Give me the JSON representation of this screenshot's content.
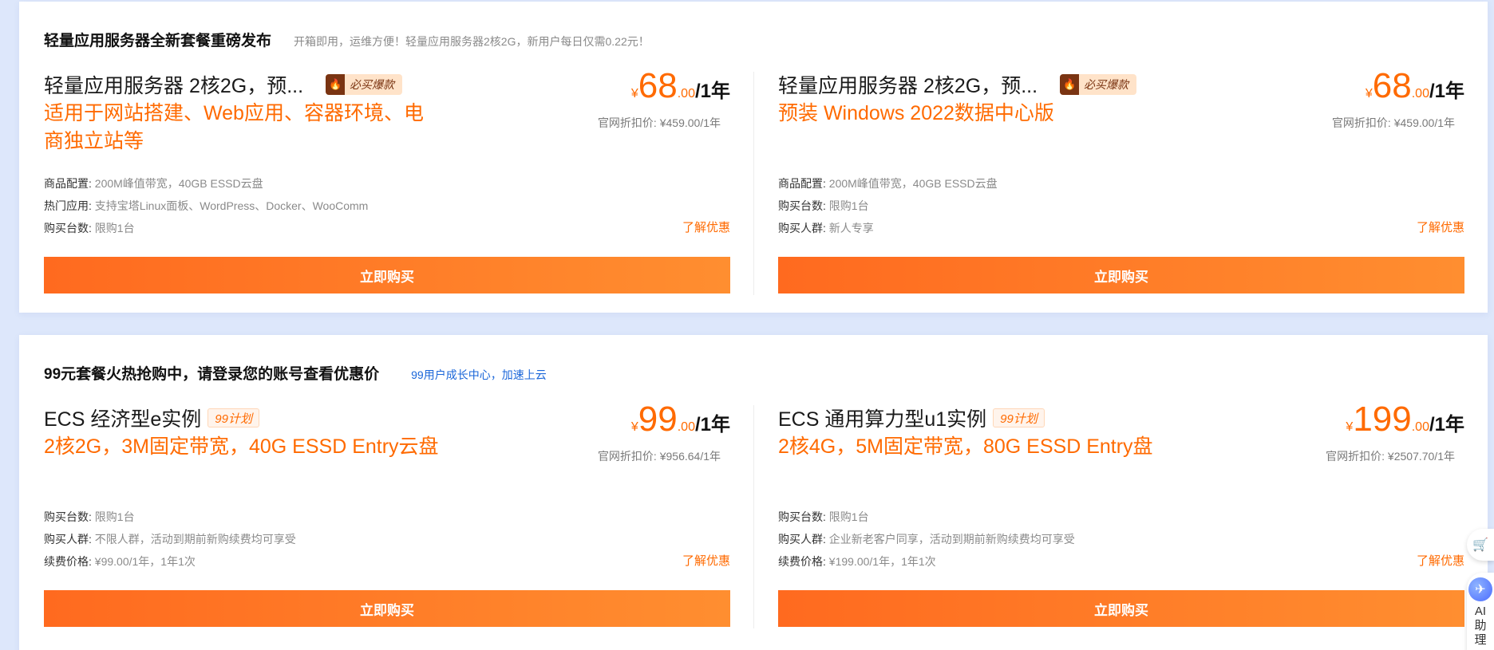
{
  "sections": [
    {
      "title": "轻量应用服务器全新套餐重磅发布",
      "subtitle": "开箱即用，运维方便！轻量应用服务器2核2G，新用户每日仅需0.22元！",
      "cards": [
        {
          "name": "轻量应用服务器 2核2G，预...",
          "badge": "必买爆款",
          "badge_icon": "fire-icon",
          "desc": "适用于网站搭建、Web应用、容器环境、电商独立站等",
          "price_symbol": "¥",
          "price_int": "68",
          "price_dec": ".00",
          "price_unit": "/1年",
          "orig_price": "官网折扣价: ¥459.00/1年",
          "specs": [
            {
              "label": "商品配置:",
              "value": "200M峰值带宽，40GB ESSD云盘"
            },
            {
              "label": "热门应用:",
              "value": "支持宝塔Linux面板、WordPress、Docker、WooComm"
            },
            {
              "label": "购买台数:",
              "value": "限购1台"
            }
          ],
          "learn": "了解优惠",
          "buy": "立即购买"
        },
        {
          "name": "轻量应用服务器 2核2G，预...",
          "badge": "必买爆款",
          "badge_icon": "fire-icon",
          "desc": "预装 Windows 2022数据中心版",
          "price_symbol": "¥",
          "price_int": "68",
          "price_dec": ".00",
          "price_unit": "/1年",
          "orig_price": "官网折扣价: ¥459.00/1年",
          "specs": [
            {
              "label": "商品配置:",
              "value": "200M峰值带宽，40GB ESSD云盘"
            },
            {
              "label": "购买台数:",
              "value": "限购1台"
            },
            {
              "label": "购买人群:",
              "value": "新人专享"
            }
          ],
          "learn": "了解优惠",
          "buy": "立即购买"
        }
      ]
    },
    {
      "title": "99元套餐火热抢购中，请登录您的账号查看优惠价",
      "subtitle": "99用户成长中心，加速上云",
      "cards": [
        {
          "name": "ECS 经济型e实例",
          "badge": "99计划",
          "desc": "2核2G，3M固定带宽，40G ESSD Entry云盘",
          "price_symbol": "¥",
          "price_int": "99",
          "price_dec": ".00",
          "price_unit": "/1年",
          "orig_price": "官网折扣价: ¥956.64/1年",
          "specs": [
            {
              "label": "购买台数:",
              "value": "限购1台"
            },
            {
              "label": "购买人群:",
              "value": "不限人群，活动到期前新购续费均可享受"
            },
            {
              "label": "续费价格:",
              "value": "¥99.00/1年，1年1次"
            }
          ],
          "learn": "了解优惠",
          "buy": "立即购买"
        },
        {
          "name": "ECS 通用算力型u1实例",
          "badge": "99计划",
          "desc": "2核4G，5M固定带宽，80G ESSD Entry盘",
          "price_symbol": "¥",
          "price_int": "199",
          "price_dec": ".00",
          "price_unit": "/1年",
          "orig_price": "官网折扣价: ¥2507.70/1年",
          "specs": [
            {
              "label": "购买台数:",
              "value": "限购1台"
            },
            {
              "label": "购买人群:",
              "value": "企业新老客户同享，活动到期前新购续费均可享受"
            },
            {
              "label": "续费价格:",
              "value": "¥199.00/1年，1年1次"
            }
          ],
          "learn": "了解优惠",
          "buy": "立即购买"
        }
      ]
    }
  ],
  "side": {
    "cart_icon": "cart-icon",
    "ai_label": "AI助理"
  },
  "colors": {
    "accent": "#ff6a00",
    "page_bg": "#dde7fb",
    "link": "#1a66d9"
  }
}
